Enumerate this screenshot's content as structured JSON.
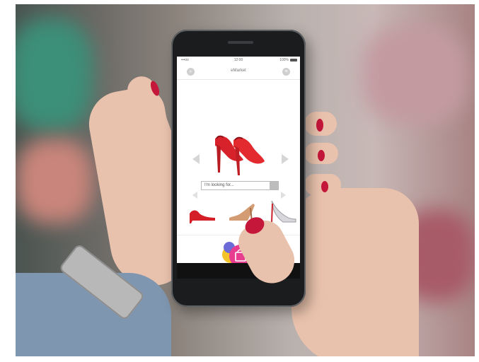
{
  "status_bar": {
    "carrier": "•••oo",
    "time": "12:00",
    "battery": "100%"
  },
  "header": {
    "title": "eMarket",
    "left_icon": "search-icon",
    "right_icon": "menu-icon"
  },
  "featured": {
    "product": "red high heel shoes",
    "prev_icon": "chevron-left-icon",
    "next_icon": "chevron-right-icon"
  },
  "search": {
    "placeholder": "I'm looking for..."
  },
  "thumbnails": [
    {
      "name": "red-pump"
    },
    {
      "name": "tan-heel"
    },
    {
      "name": "silver-heel"
    }
  ],
  "cart": {
    "icon": "shopping-bag-icon",
    "colors": [
      "#e83d8f",
      "#6b6ad6",
      "#3db6f0",
      "#f4c32a"
    ]
  }
}
